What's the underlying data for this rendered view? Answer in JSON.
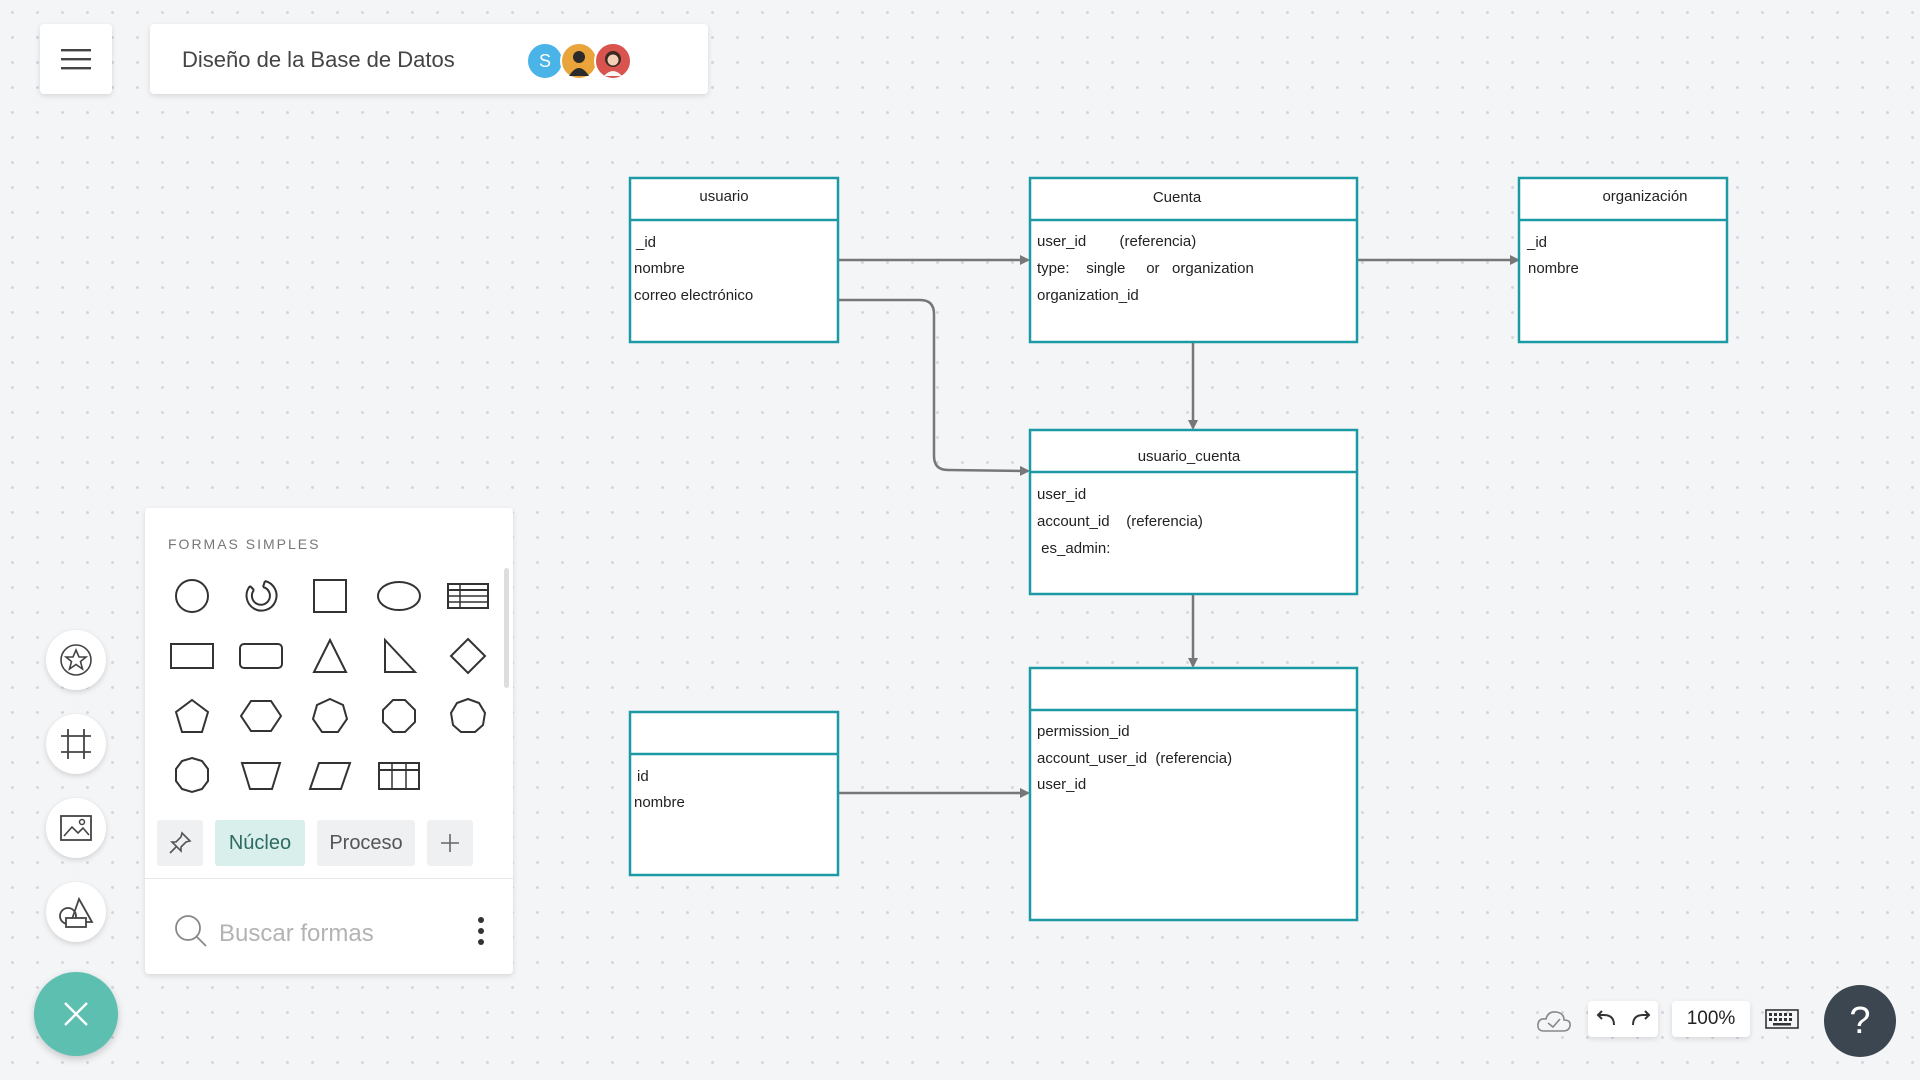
{
  "header": {
    "menu_icon": "hamburger-icon",
    "title": "Diseño de la Base de Datos",
    "collaborators": [
      {
        "initial": "S",
        "color": "#4ab3e8"
      },
      {
        "initial": "",
        "color": "#e9a43a"
      },
      {
        "initial": "",
        "color": "#d9534f"
      }
    ]
  },
  "diagram": {
    "accent": "#1b9aa5",
    "entities": [
      {
        "title": "usuario",
        "fields": [
          "_id",
          "nombre",
          "correo electrónico"
        ]
      },
      {
        "title": "Cuenta",
        "fields": [
          "user_id        (referencia)",
          "type:    single     or   organization",
          "organization_id"
        ]
      },
      {
        "title": "organización",
        "fields": [
          "_id",
          "nombre"
        ]
      },
      {
        "title": "usuario_cuenta",
        "fields": [
          "user_id",
          "account_id    (referencia)",
          " es_admin:"
        ]
      },
      {
        "title": "",
        "fields": [
          "permission_id",
          "account_user_id  (referencia)",
          "user_id"
        ]
      },
      {
        "title": "",
        "fields": [
          "id",
          "nombre"
        ]
      }
    ]
  },
  "shapes_panel": {
    "heading": "FORMAS SIMPLES",
    "tabs": {
      "core": "Núcleo",
      "process": "Proceso"
    },
    "search_placeholder": "Buscar formas"
  },
  "bottom_bar": {
    "zoom": "100%",
    "help": "?"
  }
}
